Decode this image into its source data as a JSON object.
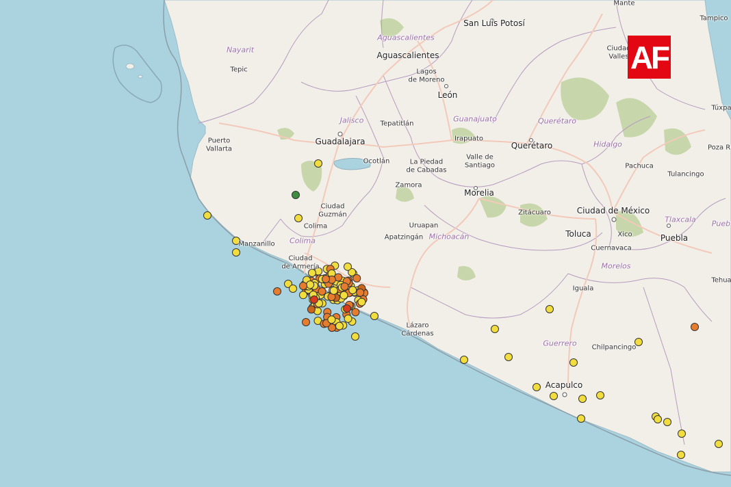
{
  "logo": {
    "text": "AF",
    "color": "#e30613"
  },
  "colors": {
    "sea": "#aad3df",
    "land": "#f2efe9",
    "forest": "#c8d7ab",
    "border": "#b59bbd",
    "road": "#f3c9b9",
    "quake_yellow": "#f2dd3e",
    "quake_orange": "#e67c2e",
    "quake_red": "#d93a1e",
    "quake_green": "#3f8c3f"
  },
  "cities": [
    {
      "id": "mante",
      "name": "Mante"
    },
    {
      "id": "tampico",
      "name": "Tampico"
    },
    {
      "id": "slp",
      "name": "San Luis Potosí"
    },
    {
      "id": "ags-state",
      "name": "Aguascalientes"
    },
    {
      "id": "ags",
      "name": "Aguascalientes"
    },
    {
      "id": "nayarit",
      "name": "Nayarit"
    },
    {
      "id": "tepic",
      "name": "Tepic"
    },
    {
      "id": "lagos",
      "name": "Lagos\nde Moreno"
    },
    {
      "id": "valles",
      "name": "Ciudad\nValles"
    },
    {
      "id": "leon",
      "name": "León"
    },
    {
      "id": "tuxpan",
      "name": "Túxpa"
    },
    {
      "id": "jalisco",
      "name": "Jalisco"
    },
    {
      "id": "guanajuato",
      "name": "Guanajuato"
    },
    {
      "id": "queretaro-state",
      "name": "Querétaro"
    },
    {
      "id": "tepatitlan",
      "name": "Tepatitlán"
    },
    {
      "id": "pvallarta",
      "name": "Puerto\nVallarta"
    },
    {
      "id": "guadalajara",
      "name": "Guadalajara"
    },
    {
      "id": "irapuato",
      "name": "Irapuato"
    },
    {
      "id": "queretaro",
      "name": "Querétaro"
    },
    {
      "id": "pozarica",
      "name": "Poza Ri"
    },
    {
      "id": "hidalgo",
      "name": "Hidalgo"
    },
    {
      "id": "ocotlan",
      "name": "Ocotlán"
    },
    {
      "id": "lapiedad",
      "name": "La Piedad\nde Cabadas"
    },
    {
      "id": "valle-santiago",
      "name": "Valle de\nSantiago"
    },
    {
      "id": "pachuca",
      "name": "Pachuca"
    },
    {
      "id": "tulancingo",
      "name": "Tulancingo"
    },
    {
      "id": "zamora",
      "name": "Zamora"
    },
    {
      "id": "morelia",
      "name": "Morelia"
    },
    {
      "id": "ciudad-guzman",
      "name": "Ciudad\nGuzmán"
    },
    {
      "id": "colima",
      "name": "Colima"
    },
    {
      "id": "zitacuaro",
      "name": "Zitácuaro"
    },
    {
      "id": "cdmx",
      "name": "Ciudad de México"
    },
    {
      "id": "tlaxcala",
      "name": "Tlaxcala"
    },
    {
      "id": "puebla-state",
      "name": "Puebl"
    },
    {
      "id": "uruapan",
      "name": "Uruapan"
    },
    {
      "id": "toluca",
      "name": "Toluca"
    },
    {
      "id": "xico",
      "name": "Xico"
    },
    {
      "id": "puebla",
      "name": "Puebla"
    },
    {
      "id": "manzanillo",
      "name": "Manzanillo"
    },
    {
      "id": "colima-state",
      "name": "Colima"
    },
    {
      "id": "apatzingan",
      "name": "Apatzingán"
    },
    {
      "id": "michoacan",
      "name": "Michoacán"
    },
    {
      "id": "cuernavaca",
      "name": "Cuernavaca"
    },
    {
      "id": "morelos",
      "name": "Morelos"
    },
    {
      "id": "armeria",
      "name": "Ciudad\nde Armería"
    },
    {
      "id": "tehua",
      "name": "Tehua"
    },
    {
      "id": "iguala",
      "name": "Iguala"
    },
    {
      "id": "lazaro",
      "name": "Lázaro\nCárdenas"
    },
    {
      "id": "guerrero",
      "name": "Guerrero"
    },
    {
      "id": "chilpancingo",
      "name": "Chilpancingo"
    },
    {
      "id": "acapulco",
      "name": "Acapulco"
    }
  ]
}
